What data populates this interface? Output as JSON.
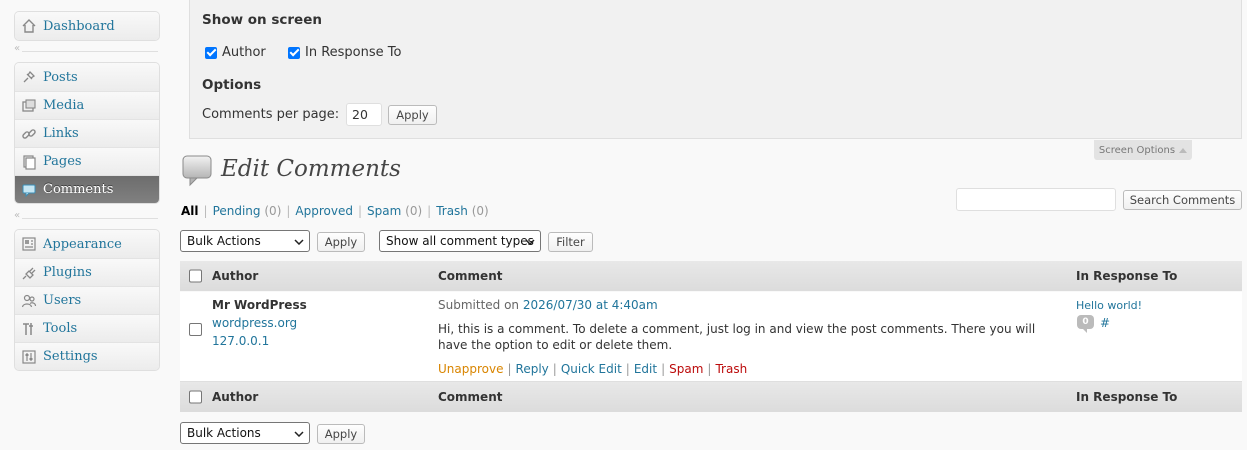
{
  "sidebar": {
    "dashboard": "Dashboard",
    "group2": [
      "Posts",
      "Media",
      "Links",
      "Pages",
      "Comments"
    ],
    "group3": [
      "Appearance",
      "Plugins",
      "Users",
      "Tools",
      "Settings"
    ],
    "separator_glyph": "«",
    "current": "Comments"
  },
  "screen_options": {
    "show_on_screen_heading": "Show on screen",
    "author_label": "Author",
    "author_checked": true,
    "in_response_label": "In Response To",
    "in_response_checked": true,
    "options_heading": "Options",
    "per_page_label": "Comments per page:",
    "per_page_value": "20",
    "apply_label": "Apply",
    "tab_label": "Screen Options"
  },
  "page": {
    "title": "Edit Comments"
  },
  "filters": {
    "all": "All",
    "pending": "Pending",
    "pending_count": "(0)",
    "approved": "Approved",
    "spam": "Spam",
    "spam_count": "(0)",
    "trash": "Trash",
    "trash_count": "(0)",
    "separator": "|"
  },
  "search": {
    "value": "",
    "button": "Search Comments"
  },
  "tablenav": {
    "bulk_actions": "Bulk Actions",
    "apply": "Apply",
    "comment_types": "Show all comment types",
    "filter": "Filter"
  },
  "table": {
    "columns": [
      "Author",
      "Comment",
      "In Response To"
    ],
    "rows": [
      {
        "author_name": "Mr WordPress",
        "author_url": "wordpress.org",
        "author_ip": "127.0.0.1",
        "submitted_prefix": "Submitted on",
        "submitted_date": "2026/07/30 at 4:40am",
        "comment_text": "Hi, this is a comment. To delete a comment, just log in and view the post comments. There you will have the option to edit or delete them.",
        "actions": [
          "Unapprove",
          "Reply",
          "Quick Edit",
          "Edit",
          "Spam",
          "Trash"
        ],
        "response_title": "Hello world!",
        "response_count": "0",
        "response_link": "#"
      }
    ]
  },
  "colors": {
    "link": "#21759b",
    "unapprove": "#d98500",
    "danger": "#bc0b0b",
    "current_menu_bg": "#777777"
  }
}
